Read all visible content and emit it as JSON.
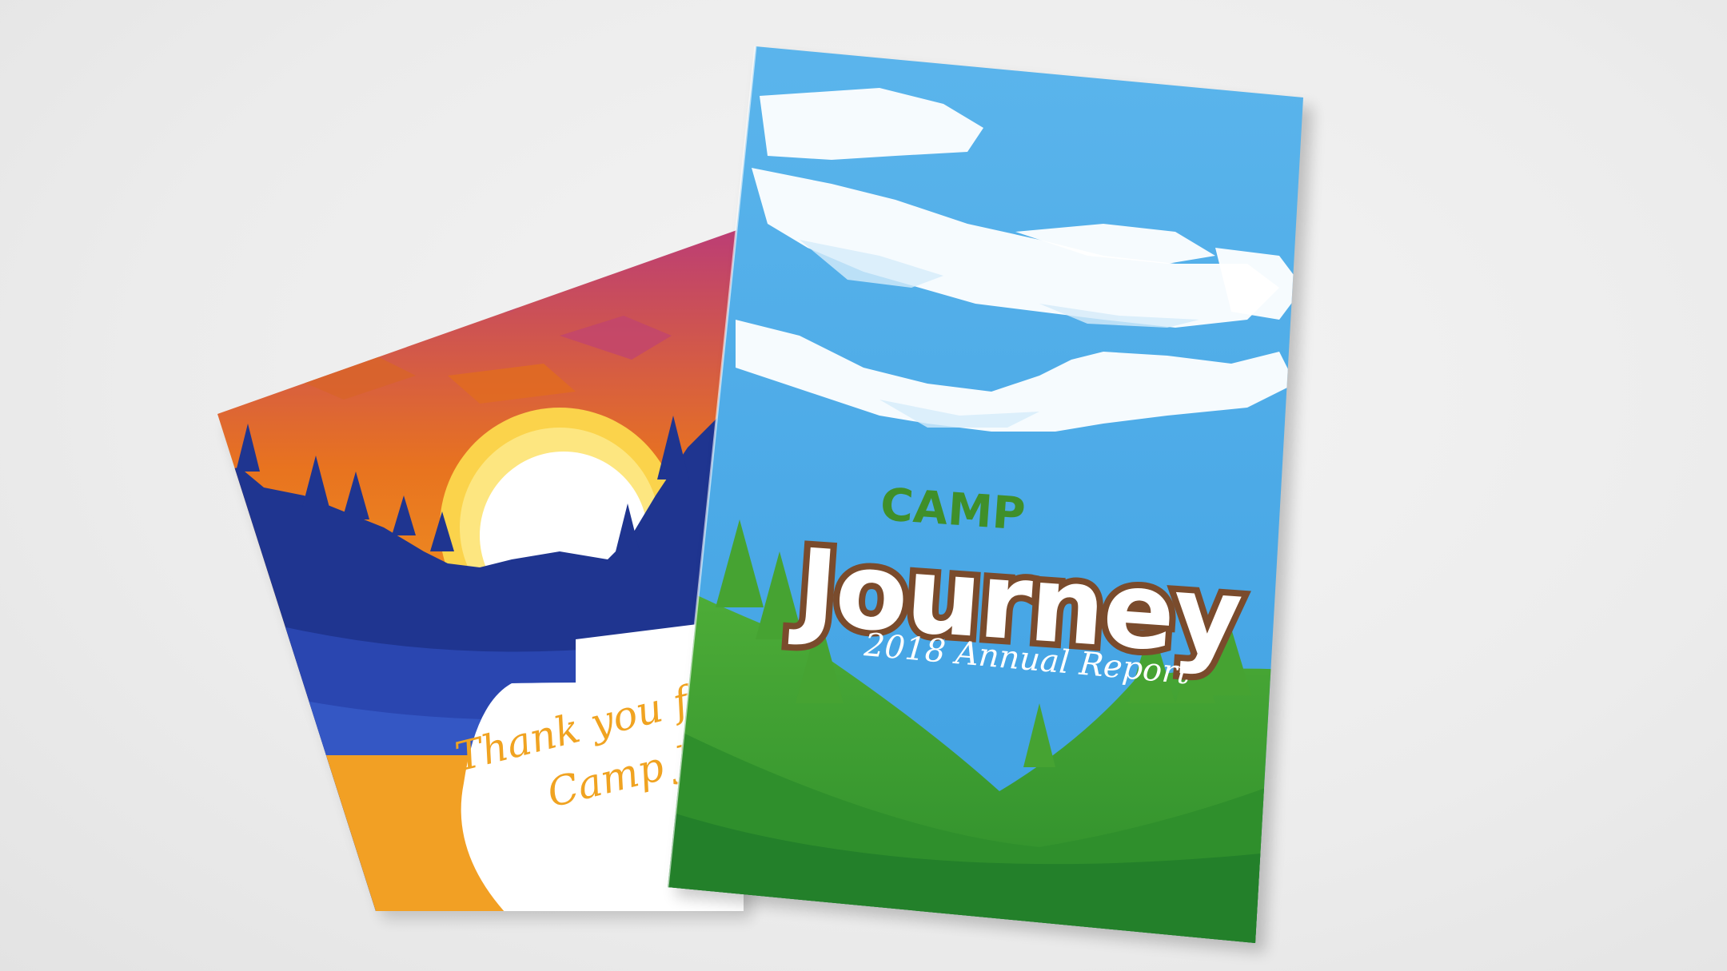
{
  "scene": {
    "background_color": "#eeeeee"
  },
  "booklet": {
    "camp_label": "CAMP",
    "title": "Journey",
    "subtitle": "2018 Annual Report",
    "colors": {
      "sky": "#4aa8e6",
      "grass": "#3c9a2c",
      "title_outline": "#7a4b2c",
      "camp_text": "#3f8f2a"
    }
  },
  "card": {
    "message_line1": "Thank you for su",
    "message_line2": "Camp Jou",
    "colors": {
      "sky": "#f2a024",
      "mountains": "#1f3590",
      "sun": "#ffffff",
      "text": "#f0a321"
    }
  }
}
